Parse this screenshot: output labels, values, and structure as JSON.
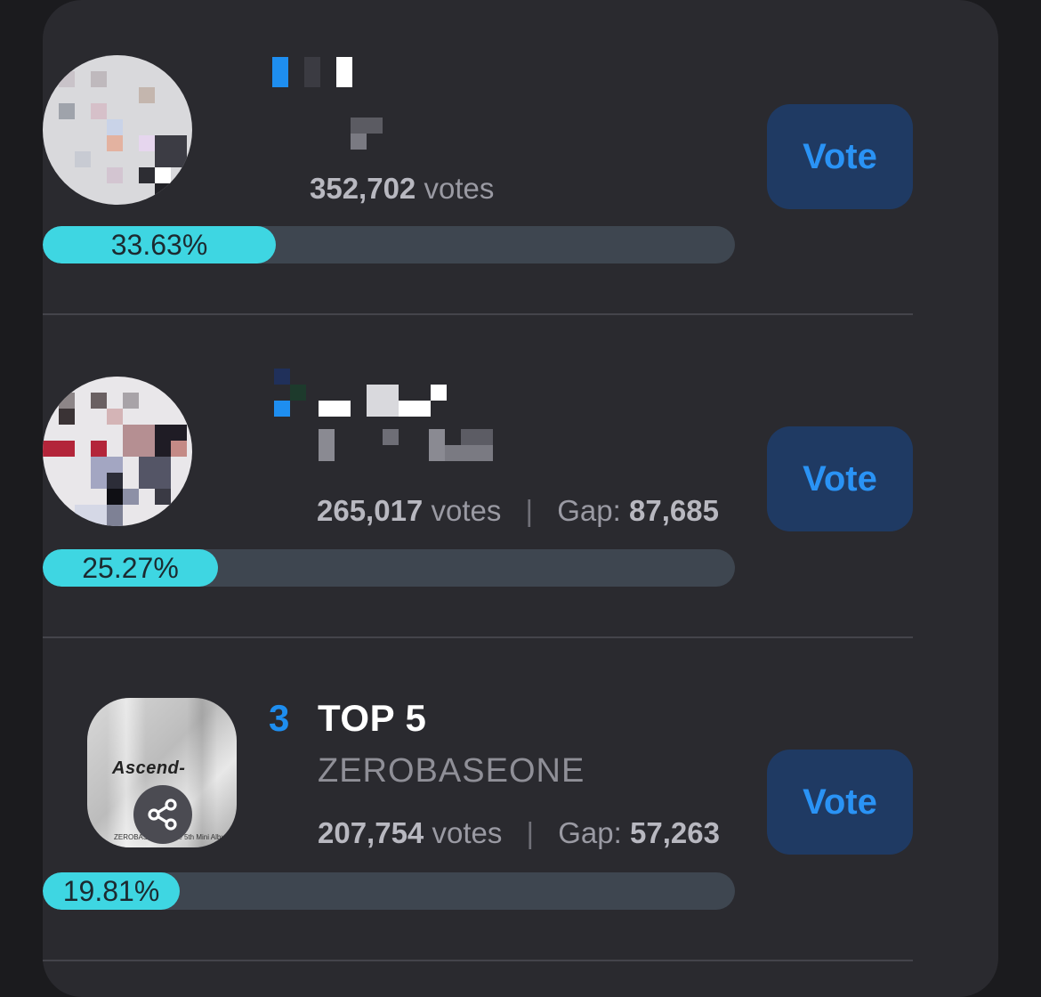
{
  "entries": [
    {
      "rank": "",
      "title": "",
      "artist": "",
      "votes_value": "352,702",
      "votes_unit": "votes",
      "gap_label": "",
      "gap_value": "",
      "percent_text": "33.63%",
      "percent": 33.63,
      "vote_label": "Vote"
    },
    {
      "rank": "",
      "title": "",
      "artist": "",
      "votes_value": "265,017",
      "votes_unit": "votes",
      "gap_label": "Gap:",
      "gap_value": "87,685",
      "percent_text": "25.27%",
      "percent": 25.27,
      "vote_label": "Vote"
    },
    {
      "rank": "3",
      "title": "TOP 5",
      "artist": "ZEROBASEONE",
      "votes_value": "207,754",
      "votes_unit": "votes",
      "gap_label": "Gap:",
      "gap_value": "57,263",
      "percent_text": "19.81%",
      "percent": 19.81,
      "vote_label": "Vote",
      "album_text": "Ascend-",
      "album_small": "ZEROBASEONE The 5th Mini Album"
    }
  ],
  "icons": {
    "share": "share-icon"
  },
  "colors": {
    "accent": "#1e8ef0",
    "bar_fill": "#3ed6e2",
    "button_bg": "#1f3a63"
  }
}
